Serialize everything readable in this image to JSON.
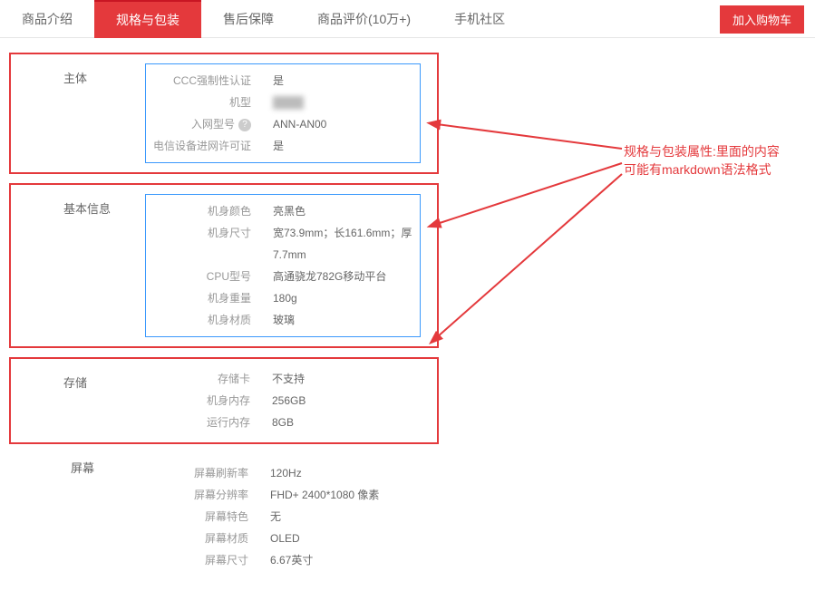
{
  "tabs": [
    "商品介绍",
    "规格与包装",
    "售后保障",
    "商品评价(10万+)",
    "手机社区"
  ],
  "activeTabIndex": 1,
  "addCartLabel": "加入购物车",
  "annotation": "规格与包装属性:里面的内容可能有markdown语法格式",
  "sections": [
    {
      "title": "主体",
      "boxed": true,
      "innerBoxed": true,
      "rows": [
        {
          "key": "CCC强制性认证",
          "val": "是"
        },
        {
          "key": "机型",
          "val": "████",
          "blur": true
        },
        {
          "key": "入网型号",
          "val": "ANN-AN00",
          "help": true
        },
        {
          "key": "电信设备进网许可证",
          "val": "是"
        }
      ]
    },
    {
      "title": "基本信息",
      "boxed": true,
      "innerBoxed": true,
      "rows": [
        {
          "key": "机身颜色",
          "val": "亮黑色"
        },
        {
          "key": "机身尺寸",
          "val": "宽73.9mm；长161.6mm；厚7.7mm"
        },
        {
          "key": "CPU型号",
          "val": "高通骁龙782G移动平台"
        },
        {
          "key": "机身重量",
          "val": "180g"
        },
        {
          "key": "机身材质",
          "val": "玻璃"
        }
      ]
    },
    {
      "title": "存储",
      "boxed": true,
      "innerBoxed": false,
      "rows": [
        {
          "key": "存储卡",
          "val": "不支持"
        },
        {
          "key": "机身内存",
          "val": "256GB"
        },
        {
          "key": "运行内存",
          "val": "8GB"
        }
      ]
    },
    {
      "title": "屏幕",
      "boxed": false,
      "innerBoxed": false,
      "rows": [
        {
          "key": "屏幕刷新率",
          "val": "120Hz"
        },
        {
          "key": "屏幕分辨率",
          "val": "FHD+ 2400*1080 像素"
        },
        {
          "key": "屏幕特色",
          "val": "无"
        },
        {
          "key": "屏幕材质",
          "val": "OLED"
        },
        {
          "key": "屏幕尺寸",
          "val": "6.67英寸"
        }
      ]
    }
  ]
}
